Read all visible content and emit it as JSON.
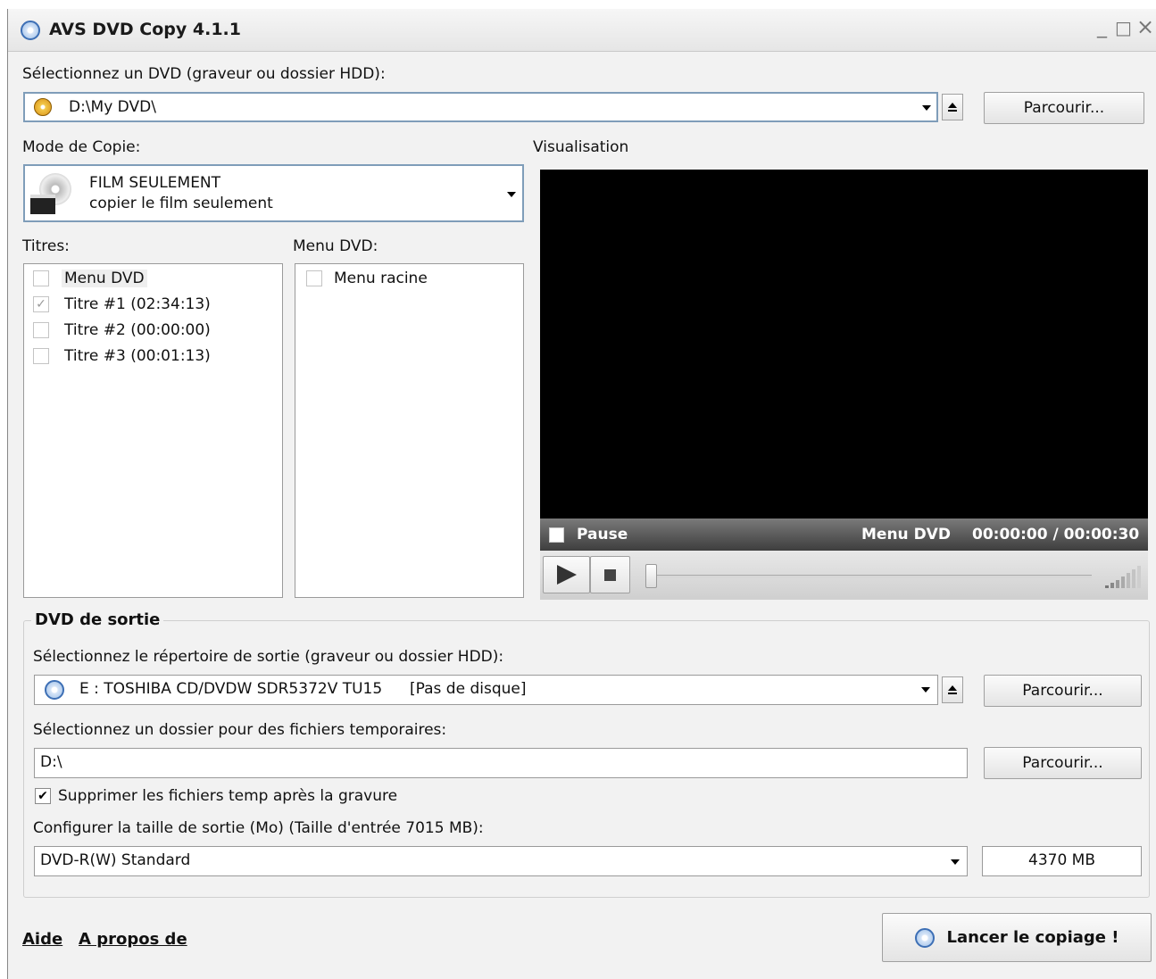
{
  "window": {
    "title": "AVS DVD Copy 4.1.1",
    "controls": {
      "minimize": "_",
      "maximize": "□",
      "close": "×"
    }
  },
  "source": {
    "label": "Sélectionnez un DVD (graveur ou dossier HDD):",
    "value": "D:\\My DVD\\",
    "browse_label": "Parcourir..."
  },
  "copy_mode": {
    "label": "Mode de Copie:",
    "title": "FILM SEULEMENT",
    "description": "copier le film seulement"
  },
  "titles": {
    "label": "Titres:",
    "items": [
      {
        "label": "Menu DVD",
        "checked": false
      },
      {
        "label": "Titre #1 (02:34:13)",
        "checked": true
      },
      {
        "label": "Titre #2 (00:00:00)",
        "checked": false
      },
      {
        "label": "Titre #3 (00:01:13)",
        "checked": false
      }
    ]
  },
  "dvd_menu": {
    "label": "Menu DVD:",
    "items": [
      {
        "label": "Menu racine",
        "checked": false
      }
    ]
  },
  "preview": {
    "label": "Visualisation",
    "pause_label": "Pause",
    "menu_label": "Menu DVD",
    "time": "00:00:00 / 00:00:30",
    "position": 0
  },
  "output": {
    "group_label": "DVD de sortie",
    "dir_label": "Sélectionnez le répertoire de sortie (graveur ou dossier HDD):",
    "drive": "E : TOSHIBA  CD/DVDW SDR5372V TU15",
    "drive_status": "[Pas de disque]",
    "browse_label": "Parcourir...",
    "temp_label": "Sélectionnez un dossier pour des fichiers temporaires:",
    "temp_value": "D:\\",
    "temp_browse_label": "Parcourir...",
    "delete_temp_label": "Supprimer les fichiers temp après la gravure",
    "delete_temp_checked": true,
    "size_label": "Configurer la taille de sortie (Mo) (Taille d'entrée 7015 MB):",
    "size_preset": "DVD-R(W) Standard",
    "size_value": "4370 MB"
  },
  "footer": {
    "help_label": "Aide",
    "about_label": "A propos de",
    "start_label": "Lancer le copiage !"
  }
}
